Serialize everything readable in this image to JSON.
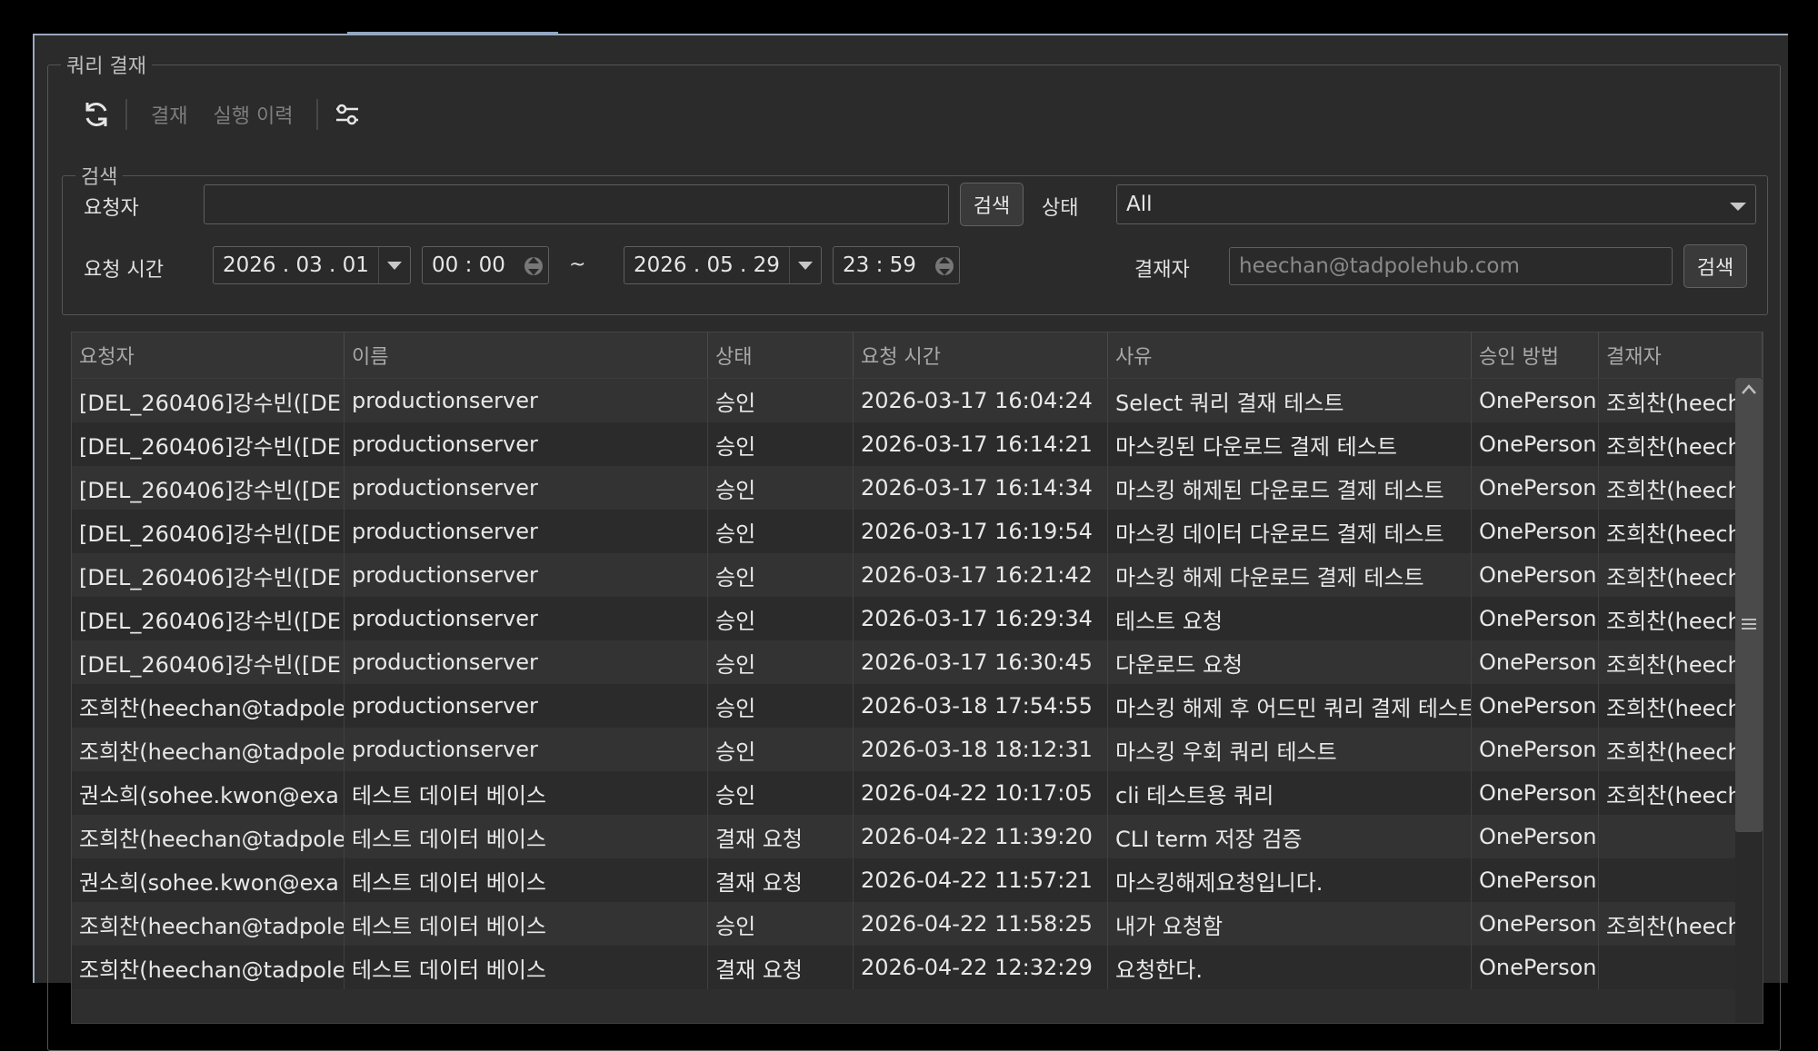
{
  "panel_title": "쿼리 결재",
  "toolbar": {
    "refresh_icon": "refresh-icon",
    "approval_label": "결재",
    "history_label": "실행 이력",
    "settings_icon": "sliders-icon"
  },
  "search": {
    "title": "검색",
    "requester_label": "요청자",
    "requester_value": "",
    "search_button": "검색",
    "status_label": "상태",
    "status_value": "All",
    "time_label": "요청 시간",
    "start_date": "2026 . 03 . 01",
    "start_time": "00 : 00",
    "range_sep": "~",
    "end_date": "2026 . 05 . 29",
    "end_time": "23 : 59",
    "approver_label": "결재자",
    "approver_placeholder": "heechan@tadpolehub.com",
    "approver_search_button": "검색"
  },
  "table": {
    "columns": [
      "요청자",
      "이름",
      "상태",
      "요청 시간",
      "사유",
      "승인 방법",
      "결재자"
    ],
    "rows": [
      [
        "[DEL_260406]강수빈([DE",
        "productionserver",
        "승인",
        "2026-03-17 16:04:24",
        "Select 쿼리 결재 테스트",
        "OnePerson",
        "조희찬(heech"
      ],
      [
        "[DEL_260406]강수빈([DE",
        "productionserver",
        "승인",
        "2026-03-17 16:14:21",
        "마스킹된 다운로드 결제 테스트",
        "OnePerson",
        "조희찬(heech"
      ],
      [
        "[DEL_260406]강수빈([DE",
        "productionserver",
        "승인",
        "2026-03-17 16:14:34",
        "마스킹 해제된 다운로드 결제 테스트",
        "OnePerson",
        "조희찬(heech"
      ],
      [
        "[DEL_260406]강수빈([DE",
        "productionserver",
        "승인",
        "2026-03-17 16:19:54",
        "마스킹 데이터 다운로드 결제 테스트",
        "OnePerson",
        "조희찬(heech"
      ],
      [
        "[DEL_260406]강수빈([DE",
        "productionserver",
        "승인",
        "2026-03-17 16:21:42",
        "마스킹 해제 다운로드 결제 테스트",
        "OnePerson",
        "조희찬(heech"
      ],
      [
        "[DEL_260406]강수빈([DE",
        "productionserver",
        "승인",
        "2026-03-17 16:29:34",
        "테스트 요청",
        "OnePerson",
        "조희찬(heech"
      ],
      [
        "[DEL_260406]강수빈([DE",
        "productionserver",
        "승인",
        "2026-03-17 16:30:45",
        "다운로드 요청",
        "OnePerson",
        "조희찬(heech"
      ],
      [
        "조희찬(heechan@tadpole",
        "productionserver",
        "승인",
        "2026-03-18 17:54:55",
        "마스킹 해제 후 어드민 쿼리 결제 테스트",
        "OnePerson",
        "조희찬(heech"
      ],
      [
        "조희찬(heechan@tadpole",
        "productionserver",
        "승인",
        "2026-03-18 18:12:31",
        "마스킹 우회 쿼리 테스트",
        "OnePerson",
        "조희찬(heech"
      ],
      [
        "권소희(sohee.kwon@exa",
        "테스트 데이터 베이스",
        "승인",
        "2026-04-22 10:17:05",
        "cli 테스트용 쿼리",
        "OnePerson",
        "조희찬(heech"
      ],
      [
        "조희찬(heechan@tadpole",
        "테스트 데이터 베이스",
        "결재 요청",
        "2026-04-22 11:39:20",
        "CLI term 저장 검증",
        "OnePerson",
        ""
      ],
      [
        "권소희(sohee.kwon@exa",
        "테스트 데이터 베이스",
        "결재 요청",
        "2026-04-22 11:57:21",
        "마스킹해제요청입니다.",
        "OnePerson",
        ""
      ],
      [
        "조희찬(heechan@tadpole",
        "테스트 데이터 베이스",
        "승인",
        "2026-04-22 11:58:25",
        "내가 요청함",
        "OnePerson",
        "조희찬(heech"
      ],
      [
        "조희찬(heechan@tadpole",
        "테스트 데이터 베이스",
        "결재 요청",
        "2026-04-22 12:32:29",
        "요청한다.",
        "OnePerson",
        ""
      ]
    ]
  }
}
